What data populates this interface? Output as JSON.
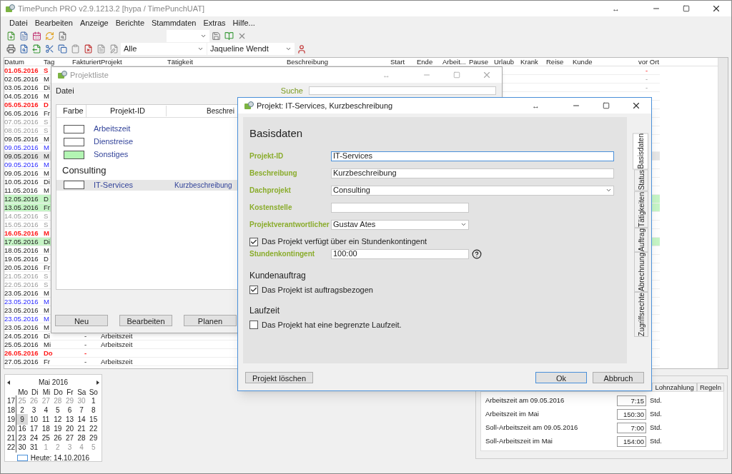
{
  "window": {
    "title": "TimePunch PRO v2.9.1213.2 [hypa / TimePunchUAT]",
    "resize_glyph": "↔"
  },
  "menu": [
    "Datei",
    "Bearbeiten",
    "Anzeige",
    "Berichte",
    "Stammdaten",
    "Extras",
    "Hilfe..."
  ],
  "toolbar": {
    "filter": "Alle",
    "user": "Jaqueline Wendt"
  },
  "table": {
    "columns": [
      "Datum",
      "Tag",
      "Fakturiert",
      "Projekt",
      "Tätigkeit",
      "Beschreibung",
      "Start",
      "Ende",
      "Arbeit...",
      "Pause",
      "Urlaub",
      "Krank",
      "Reise",
      "Kunde",
      "vor Ort"
    ],
    "rows": [
      {
        "date": "01.05.2016",
        "day": "S",
        "kind": "holiday",
        "selected": false,
        "on_site": "-"
      },
      {
        "date": "02.05.2016",
        "day": "M",
        "kind": "workday",
        "selected": false,
        "on_site": "-"
      },
      {
        "date": "03.05.2016",
        "day": "Di",
        "kind": "workday",
        "selected": false,
        "on_site": "-"
      },
      {
        "date": "04.05.2016",
        "day": "M",
        "kind": "workday",
        "selected": false
      },
      {
        "date": "05.05.2016",
        "day": "D",
        "kind": "holiday",
        "selected": false
      },
      {
        "date": "06.05.2016",
        "day": "Fr",
        "kind": "workday",
        "selected": false
      },
      {
        "date": "07.05.2016",
        "day": "S",
        "kind": "weekend",
        "selected": false
      },
      {
        "date": "08.05.2016",
        "day": "S",
        "kind": "weekend",
        "selected": false
      },
      {
        "date": "09.05.2016",
        "day": "M",
        "kind": "workday",
        "selected": false
      },
      {
        "date": "09.05.2016",
        "day": "M",
        "kind": "marked",
        "selected": false
      },
      {
        "date": "09.05.2016",
        "day": "M",
        "kind": "workday",
        "selected": true
      },
      {
        "date": "09.05.2016",
        "day": "M",
        "kind": "marked",
        "selected": false
      },
      {
        "date": "09.05.2016",
        "day": "M",
        "kind": "workday",
        "selected": false
      },
      {
        "date": "10.05.2016",
        "day": "Di",
        "kind": "workday",
        "selected": false
      },
      {
        "date": "11.05.2016",
        "day": "M",
        "kind": "workday",
        "selected": false
      },
      {
        "date": "12.05.2016",
        "day": "D",
        "kind": "workday",
        "selected": false,
        "color": "#c6f5c6"
      },
      {
        "date": "13.05.2016",
        "day": "Fr",
        "kind": "workday",
        "selected": false,
        "color": "#c6f5c6"
      },
      {
        "date": "14.05.2016",
        "day": "S",
        "kind": "weekend",
        "selected": false
      },
      {
        "date": "15.05.2016",
        "day": "S",
        "kind": "weekend",
        "selected": false
      },
      {
        "date": "16.05.2016",
        "day": "M",
        "kind": "holiday",
        "selected": false
      },
      {
        "date": "17.05.2016",
        "day": "Di",
        "kind": "workday",
        "selected": false,
        "color": "#c6f5c6"
      },
      {
        "date": "18.05.2016",
        "day": "M",
        "kind": "workday",
        "selected": false
      },
      {
        "date": "19.05.2016",
        "day": "D",
        "kind": "workday",
        "selected": false
      },
      {
        "date": "20.05.2016",
        "day": "Fr",
        "kind": "workday",
        "selected": false
      },
      {
        "date": "21.05.2016",
        "day": "S",
        "kind": "weekend",
        "selected": false
      },
      {
        "date": "22.05.2016",
        "day": "S",
        "kind": "weekend",
        "selected": false
      },
      {
        "date": "23.05.2016",
        "day": "M",
        "kind": "workday",
        "selected": false
      },
      {
        "date": "23.05.2016",
        "day": "M",
        "kind": "marked",
        "selected": false
      },
      {
        "date": "23.05.2016",
        "day": "M",
        "kind": "workday",
        "selected": false
      },
      {
        "date": "23.05.2016",
        "day": "M",
        "kind": "marked",
        "selected": false
      },
      {
        "date": "23.05.2016",
        "day": "M",
        "kind": "workday",
        "selected": false
      },
      {
        "date": "24.05.2016",
        "day": "Di",
        "kind": "workday",
        "selected": false,
        "billed": "-",
        "project": "Arbeitszeit"
      },
      {
        "date": "25.05.2016",
        "day": "Mi",
        "kind": "workday",
        "selected": false,
        "billed": "-",
        "project": "Arbeitszeit"
      },
      {
        "date": "26.05.2016",
        "day": "Do",
        "kind": "holiday",
        "selected": false,
        "billed": "-"
      },
      {
        "date": "27.05.2016",
        "day": "Fr",
        "kind": "workday",
        "selected": false,
        "billed": "-",
        "project": "Arbeitszeit"
      }
    ]
  },
  "calendar": {
    "month": "Mai 2016",
    "weekdays": [
      "Mo",
      "Di",
      "Mi",
      "Do",
      "Fr",
      "Sa",
      "So"
    ],
    "weeks": [
      {
        "week": "17",
        "days": [
          {
            "d": "25",
            "other": true,
            "selected": false
          },
          {
            "d": "26",
            "other": true,
            "selected": false
          },
          {
            "d": "27",
            "other": true,
            "selected": false
          },
          {
            "d": "28",
            "other": true,
            "selected": false
          },
          {
            "d": "29",
            "other": true,
            "selected": false
          },
          {
            "d": "30",
            "other": true,
            "selected": false
          },
          {
            "d": "1",
            "other": false,
            "selected": false
          }
        ]
      },
      {
        "week": "18",
        "days": [
          {
            "d": "2",
            "other": false,
            "selected": false
          },
          {
            "d": "3",
            "other": false,
            "selected": false
          },
          {
            "d": "4",
            "other": false,
            "selected": false
          },
          {
            "d": "5",
            "other": false,
            "selected": false
          },
          {
            "d": "6",
            "other": false,
            "selected": false
          },
          {
            "d": "7",
            "other": false,
            "selected": false
          },
          {
            "d": "8",
            "other": false,
            "selected": false
          }
        ]
      },
      {
        "week": "19",
        "days": [
          {
            "d": "9",
            "other": false,
            "selected": true
          },
          {
            "d": "10",
            "other": false,
            "selected": false
          },
          {
            "d": "11",
            "other": false,
            "selected": false
          },
          {
            "d": "12",
            "other": false,
            "selected": false
          },
          {
            "d": "13",
            "other": false,
            "selected": false
          },
          {
            "d": "14",
            "other": false,
            "selected": false
          },
          {
            "d": "15",
            "other": false,
            "selected": false
          }
        ]
      },
      {
        "week": "20",
        "days": [
          {
            "d": "16",
            "other": false,
            "selected": false
          },
          {
            "d": "17",
            "other": false,
            "selected": false
          },
          {
            "d": "18",
            "other": false,
            "selected": false
          },
          {
            "d": "19",
            "other": false,
            "selected": false
          },
          {
            "d": "20",
            "other": false,
            "selected": false
          },
          {
            "d": "21",
            "other": false,
            "selected": false
          },
          {
            "d": "22",
            "other": false,
            "selected": false
          }
        ]
      },
      {
        "week": "21",
        "days": [
          {
            "d": "23",
            "other": false,
            "selected": false
          },
          {
            "d": "24",
            "other": false,
            "selected": false
          },
          {
            "d": "25",
            "other": false,
            "selected": false
          },
          {
            "d": "26",
            "other": false,
            "selected": false
          },
          {
            "d": "27",
            "other": false,
            "selected": false
          },
          {
            "d": "28",
            "other": false,
            "selected": false
          },
          {
            "d": "29",
            "other": false,
            "selected": false
          }
        ]
      },
      {
        "week": "22",
        "days": [
          {
            "d": "30",
            "other": false,
            "selected": false
          },
          {
            "d": "31",
            "other": false,
            "selected": false
          },
          {
            "d": "1",
            "other": true,
            "selected": false
          },
          {
            "d": "2",
            "other": true,
            "selected": false
          },
          {
            "d": "3",
            "other": true,
            "selected": false
          },
          {
            "d": "4",
            "other": true,
            "selected": false
          },
          {
            "d": "5",
            "other": true,
            "selected": false
          }
        ]
      }
    ],
    "today": "Heute: 14.10.2016"
  },
  "summary": {
    "tabs": [
      {
        "label": "Lohnzahlung",
        "selected": false
      },
      {
        "label": "Regeln",
        "selected": false
      }
    ],
    "rows": [
      {
        "label": "Arbeitszeit am 09.05.2016",
        "value": "7:15",
        "unit": "Std."
      },
      {
        "label": "Arbeitszeit im Mai",
        "value": "150:30",
        "unit": "Std."
      },
      {
        "label": "Soll-Arbeitszeit am 09.05.2016",
        "value": "7:00",
        "unit": "Std."
      },
      {
        "label": "Soll-Arbeitszeit im Mai",
        "value": "154:00",
        "unit": "Std."
      }
    ]
  },
  "project_list": {
    "title": "Projektliste",
    "resize_glyph": "↔",
    "menu": [
      "Datei"
    ],
    "search_label": "Suche",
    "columns": [
      "Farbe",
      "Projekt-ID",
      "Beschrei"
    ],
    "items": [
      {
        "kind": "item",
        "id": "Arbeitszeit",
        "color": "#ffffff",
        "selected": false
      },
      {
        "kind": "item",
        "id": "Dienstreise",
        "color": "#ffffff",
        "selected": false
      },
      {
        "kind": "item",
        "id": "Sonstiges",
        "color": "#b3f5b3",
        "selected": false
      },
      {
        "kind": "group",
        "label": "Consulting"
      },
      {
        "kind": "item",
        "id": "IT-Services",
        "description": "Kurzbeschreibung",
        "color": "#ffffff",
        "selected": true
      }
    ],
    "buttons": [
      "Neu",
      "Bearbeiten",
      "Planen"
    ]
  },
  "dialog": {
    "title": "Projekt: IT-Services, Kurzbeschreibung",
    "resize_glyph": "↔",
    "heading": "Basisdaten",
    "fields": [
      {
        "kind": "text",
        "label": "Projekt-ID",
        "value": "IT-Services",
        "focused": true
      },
      {
        "kind": "text",
        "label": "Beschreibung",
        "value": "Kurzbeschreibung",
        "focused": false
      },
      {
        "kind": "select",
        "label": "Dachprojekt",
        "value": "Consulting",
        "focused": false
      },
      {
        "kind": "text",
        "label": "Kostenstelle",
        "focused": false
      },
      {
        "kind": "select",
        "label": "Projektverantwortlicher",
        "value": "Gustav Ates",
        "focused": false
      }
    ],
    "quota_check": {
      "label": "Das Projekt verfügt über ein Stundenkontingent",
      "checked": true
    },
    "quota_field": {
      "label": "Stundenkontingent",
      "value": "100:00"
    },
    "sections": [
      {
        "title": "Kundenauftrag",
        "check": {
          "label": "Das Projekt ist auftragsbezogen",
          "checked": true
        }
      },
      {
        "title": "Laufzeit",
        "check": {
          "label": "Das Projekt hat eine begrenzte Laufzeit.",
          "checked": false
        }
      }
    ],
    "tabs": [
      {
        "label": "Basisdaten",
        "selected": true
      },
      {
        "label": "Status",
        "selected": false
      },
      {
        "label": "Tätigkeiten",
        "selected": false
      },
      {
        "label": "Auftrag",
        "selected": false
      },
      {
        "label": "Abrechnung",
        "selected": false
      },
      {
        "label": "Zugriffsrechte",
        "selected": false
      }
    ],
    "delete_button": "Projekt löschen",
    "ok_button": "Ok",
    "cancel_button": "Abbruch"
  }
}
